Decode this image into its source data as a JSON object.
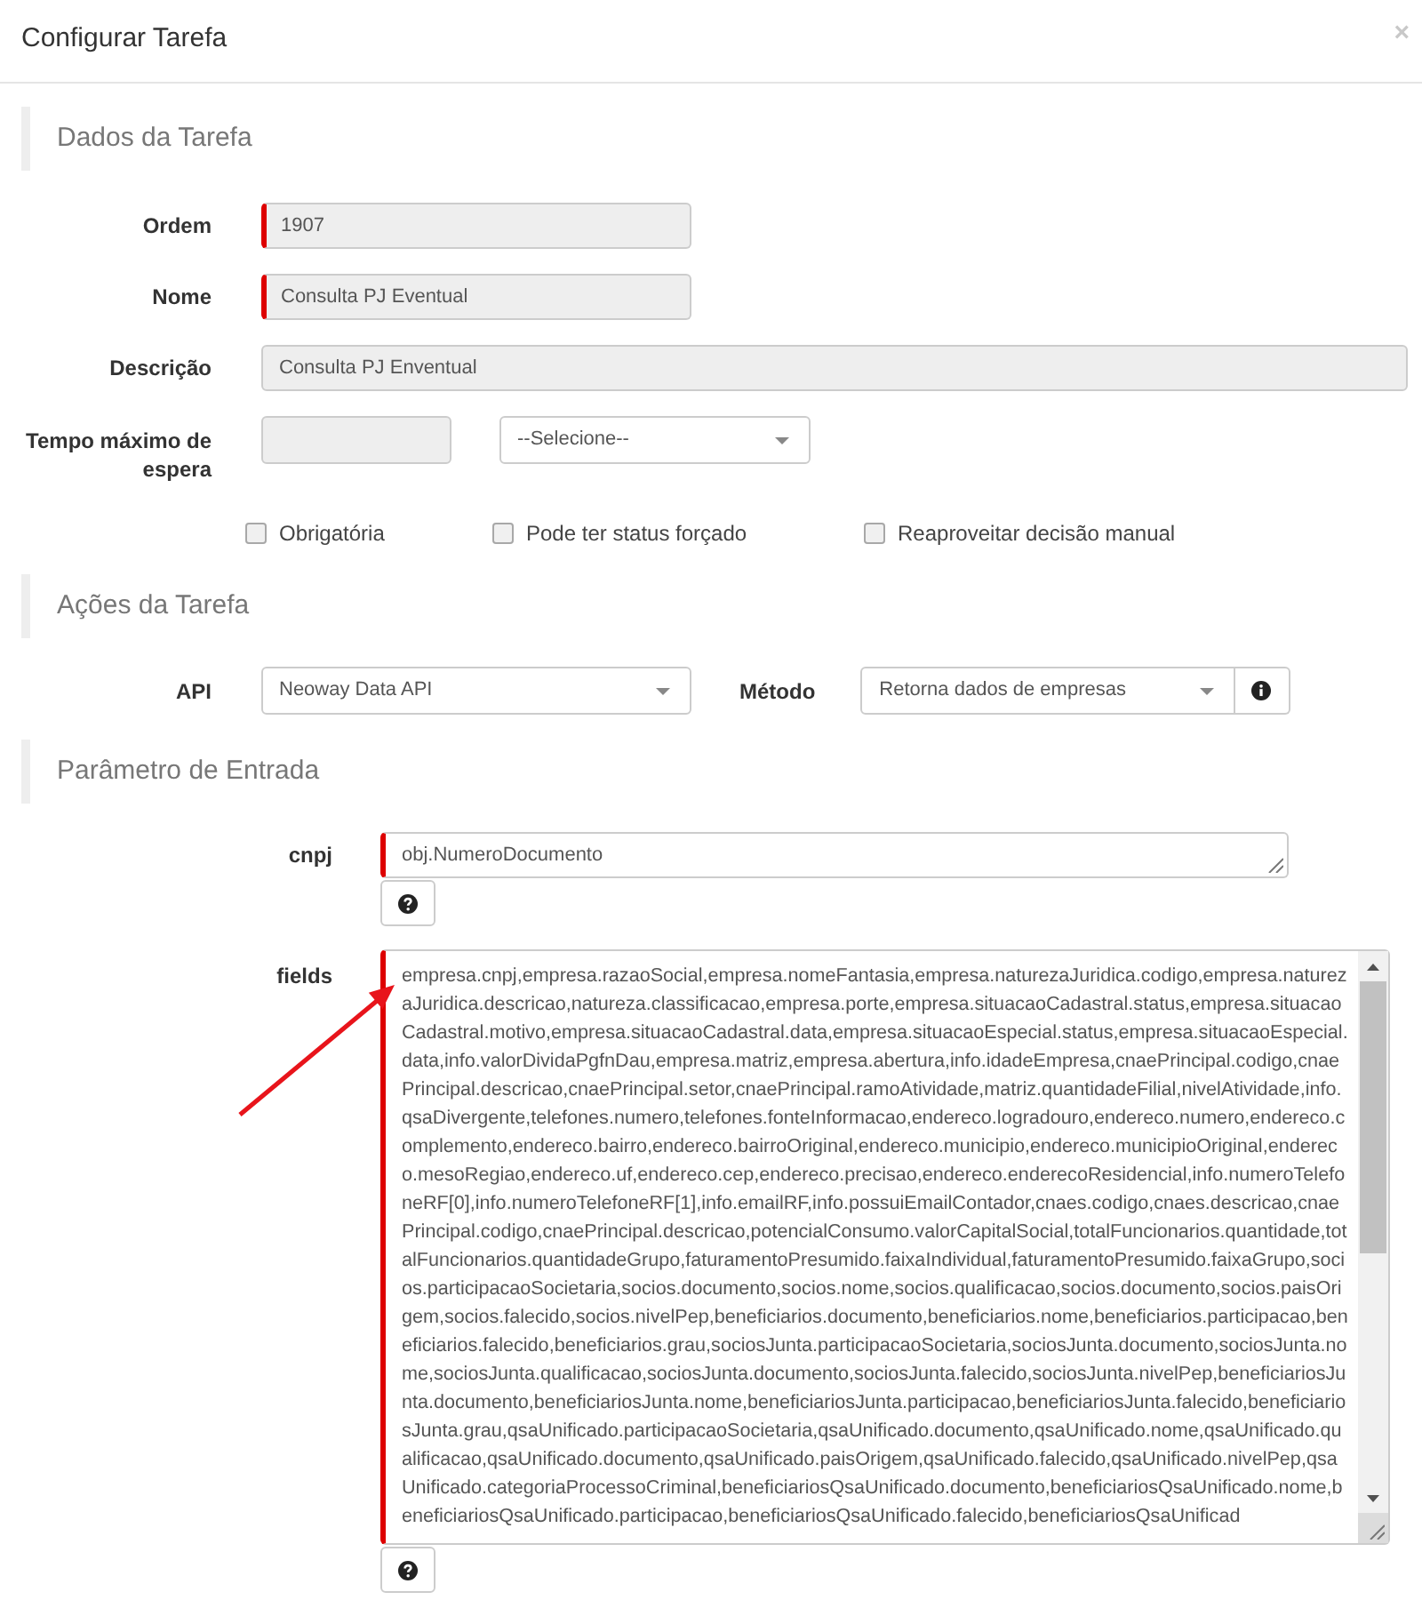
{
  "dialog": {
    "title": "Configurar Tarefa",
    "close": "×"
  },
  "dados_da_tarefa": {
    "heading": "Dados da Tarefa",
    "fields": [
      {
        "label": "Ordem",
        "value": "1907",
        "required": true
      },
      {
        "label": "Nome",
        "value": "Consulta PJ Eventual",
        "required": true
      },
      {
        "label": "Descrição",
        "value": "Consulta PJ Enventual",
        "required": false
      }
    ],
    "tempo_maximo": {
      "label": "Tempo máximo de espera",
      "unit_select": "--Selecione--"
    },
    "checkboxes": [
      {
        "label": "Obrigatória",
        "checked": false
      },
      {
        "label": "Pode ter status forçado",
        "checked": false
      },
      {
        "label": "Reaproveitar decisão manual",
        "checked": false
      }
    ]
  },
  "acoes_da_tarefa": {
    "heading": "Ações da Tarefa",
    "api": {
      "label": "API",
      "value": "Neoway Data API"
    },
    "metodo": {
      "label": "Método",
      "value": "Retorna dados de empresas"
    }
  },
  "parametro_de_entrada": {
    "heading": "Parâmetro de Entrada",
    "params": [
      {
        "kind": "line",
        "label": "cnpj",
        "value": "obj.NumeroDocumento",
        "required": true
      },
      {
        "kind": "block",
        "label": "fields",
        "value": "empresa.cnpj,empresa.razaoSocial,empresa.nomeFantasia,empresa.naturezaJuridica.codigo,empresa.naturezaJuridica.descricao,natureza.classificacao,empresa.porte,empresa.situacaoCadastral.status,empresa.situacaoCadastral.motivo,empresa.situacaoCadastral.data,empresa.situacaoEspecial.status,empresa.situacaoEspecial.data,info.valorDividaPgfnDau,empresa.matriz,empresa.abertura,info.idadeEmpresa,cnaePrincipal.codigo,cnaePrincipal.descricao,cnaePrincipal.setor,cnaePrincipal.ramoAtividade,matriz.quantidadeFilial,nivelAtividade,info.qsaDivergente,telefones.numero,telefones.fonteInformacao,endereco.logradouro,endereco.numero,endereco.complemento,endereco.bairro,endereco.bairroOriginal,endereco.municipio,endereco.municipioOriginal,endereco.mesoRegiao,endereco.uf,endereco.cep,endereco.precisao,endereco.enderecoResidencial,info.numeroTelefoneRF[0],info.numeroTelefoneRF[1],info.emailRF,info.possuiEmailContador,cnaes.codigo,cnaes.descricao,cnaePrincipal.codigo,cnaePrincipal.descricao,potencialConsumo.valorCapitalSocial,totalFuncionarios.quantidade,totalFuncionarios.quantidadeGrupo,faturamentoPresumido.faixaIndividual,faturamentoPresumido.faixaGrupo,socios.participacaoSocietaria,socios.documento,socios.nome,socios.qualificacao,socios.documento,socios.paisOrigem,socios.falecido,socios.nivelPep,beneficiarios.documento,beneficiarios.nome,beneficiarios.participacao,beneficiarios.falecido,beneficiarios.grau,sociosJunta.participacaoSocietaria,sociosJunta.documento,sociosJunta.nome,sociosJunta.qualificacao,sociosJunta.documento,sociosJunta.falecido,sociosJunta.nivelPep,beneficiariosJunta.documento,beneficiariosJunta.nome,beneficiariosJunta.participacao,beneficiariosJunta.falecido,beneficiariosJunta.grau,qsaUnificado.participacaoSocietaria,qsaUnificado.documento,qsaUnificado.nome,qsaUnificado.qualificacao,qsaUnificado.documento,qsaUnificado.paisOrigem,qsaUnificado.falecido,qsaUnificado.nivelPep,qsaUnificado.categoriaProcessoCriminal,beneficiariosQsaUnificado.documento,beneficiariosQsaUnificado.nome,beneficiariosQsaUnificado.participacao,beneficiariosQsaUnificado.falecido,beneficiariosQsaUnificad",
        "required": true
      }
    ]
  }
}
